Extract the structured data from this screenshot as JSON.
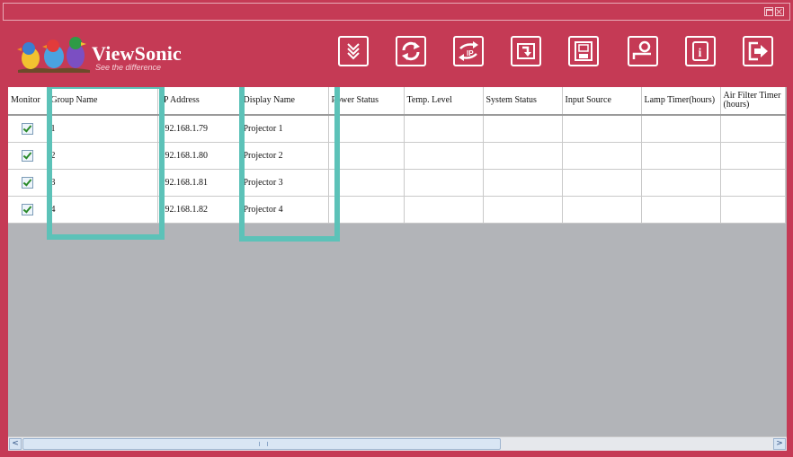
{
  "window": {
    "background": "#c53a55",
    "highlight_color": "#5cc2b8"
  },
  "logo": {
    "brand": "ViewSonic",
    "tagline": "See the difference"
  },
  "toolbar": {
    "buttons": [
      {
        "name": "chevron-down-icon"
      },
      {
        "name": "refresh-icon"
      },
      {
        "name": "ip-setting-icon",
        "label": "IP"
      },
      {
        "name": "import-icon"
      },
      {
        "name": "save-icon"
      },
      {
        "name": "settings-key-icon"
      },
      {
        "name": "info-icon",
        "label": "i"
      },
      {
        "name": "exit-icon"
      }
    ]
  },
  "table": {
    "columns": [
      {
        "key": "monitor",
        "label": "Monitor"
      },
      {
        "key": "group",
        "label": "Group Name"
      },
      {
        "key": "ip",
        "label": "IP Address"
      },
      {
        "key": "display",
        "label": "Display Name"
      },
      {
        "key": "power",
        "label": "Power Status"
      },
      {
        "key": "temp",
        "label": "Temp. Level"
      },
      {
        "key": "system",
        "label": "System Status"
      },
      {
        "key": "input",
        "label": "Input Source"
      },
      {
        "key": "lamp",
        "label": "Lamp Timer(hours)"
      },
      {
        "key": "filter",
        "label": "Air Filter Timer (hours)"
      }
    ],
    "rows": [
      {
        "monitor": true,
        "group": "1",
        "ip": "192.168.1.79",
        "display": "Projector 1"
      },
      {
        "monitor": true,
        "group": "2",
        "ip": "192.168.1.80",
        "display": "Projector 2"
      },
      {
        "monitor": true,
        "group": "3",
        "ip": "192.168.1.81",
        "display": "Projector 3"
      },
      {
        "monitor": true,
        "group": "4",
        "ip": "192.168.1.82",
        "display": "Projector 4"
      }
    ]
  },
  "scrollbar": {
    "left_arrow": "<",
    "right_arrow": ">"
  }
}
